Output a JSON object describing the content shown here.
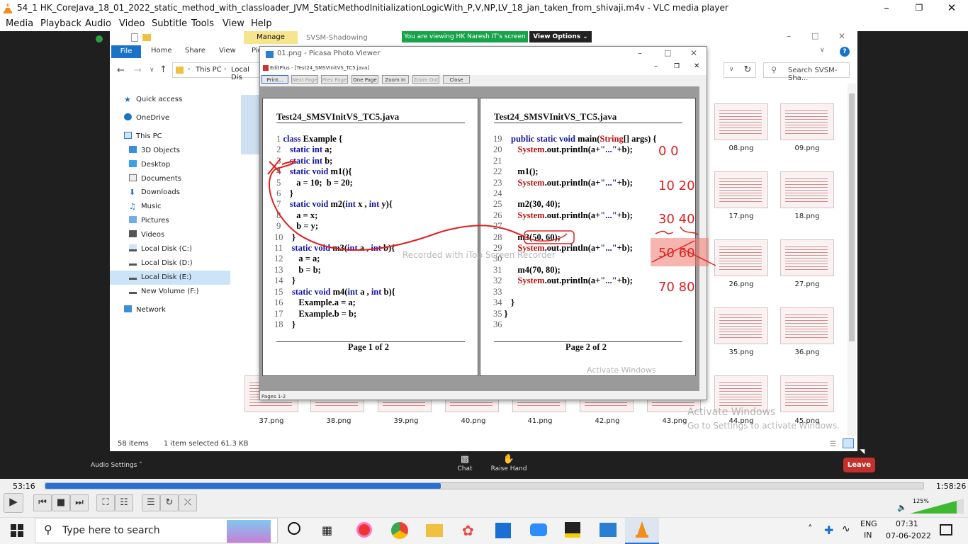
{
  "window": {
    "title": "54_1 HK_CoreJava_18_01_2022_static_method_with_classloader_JVM_StaticMethodInitializationLogicWith_P,V,NP,LV_18_jan_taken_from_shivaji.m4v - VLC media player"
  },
  "menu": [
    "Media",
    "Playback",
    "Audio",
    "Video",
    "Subtitle",
    "Tools",
    "View",
    "Help"
  ],
  "explorer": {
    "manage": "Manage",
    "ribbon_title": "SVSM-Shadowing",
    "ribbon_tabs": [
      "File",
      "Home",
      "Share",
      "View",
      "Pic"
    ],
    "breadcrumb": [
      "This PC",
      "Local Dis"
    ],
    "search_placeholder": "Search SVSM-Sha...",
    "nav": [
      "Quick access",
      "OneDrive",
      "This PC",
      "3D Objects",
      "Desktop",
      "Documents",
      "Downloads",
      "Music",
      "Pictures",
      "Videos",
      "Local Disk (C:)",
      "Local Disk (D:)",
      "Local Disk (E:)",
      "New Volume (F:)",
      "Network"
    ],
    "thumbs": [
      "08.png",
      "09.png",
      "17.png",
      "18.png",
      "26.png",
      "27.png",
      "35.png",
      "36.png",
      "37.png",
      "38.png",
      "39.png",
      "40.png",
      "41.png",
      "42.png",
      "43.png",
      "44.png",
      "45.png"
    ],
    "status_items": "58 items",
    "status_selected": "1 item selected  61.3 KB"
  },
  "meet": {
    "banner": "You are viewing HK Naresh IT's screen",
    "view_options": "View Options",
    "audio_settings": "Audio Settings",
    "chat": "Chat",
    "raise_hand": "Raise Hand",
    "leave": "Leave"
  },
  "picasa": {
    "title": "01.png - Picasa Photo Viewer",
    "editplus_title": "EditPlus - [Test24_SMSVInitVS_TC5.java]",
    "toolbar": [
      "Print...",
      "Next Page",
      "Prev Page",
      "One Page",
      "Zoom In",
      "Zoom Out",
      "Close"
    ],
    "pages_label": "Pages 1-2"
  },
  "doc": {
    "filename": "Test24_SMSVInitVS_TC5.java",
    "page1_footer": "Page 1 of 2",
    "page2_footer": "Page 2 of 2"
  },
  "watermarks": {
    "recorder": "Recorded with iTop Screen Recorder",
    "activate1": "Activate Windows",
    "activate2": "Activate Windows",
    "activate_hint": "Go to Settings to activate Windows."
  },
  "annotations": [
    "0 0",
    "10 20",
    "30 40",
    "50 60",
    "70 80"
  ],
  "player": {
    "elapsed": "53:16",
    "total": "1:58:26",
    "progress": 0.45,
    "volume": "125%"
  },
  "taskbar": {
    "search_placeholder": "Type here to search",
    "lang1": "ENG",
    "lang2": "IN",
    "time": "07:31",
    "date": "07-06-2022"
  },
  "colors": {
    "keyword": "#1515a8",
    "system": "#c01010",
    "annotation": "#e02020",
    "meet_green": "#18a24a",
    "leave_red": "#c4302b",
    "vlc_progress": "#2a6fd4"
  }
}
